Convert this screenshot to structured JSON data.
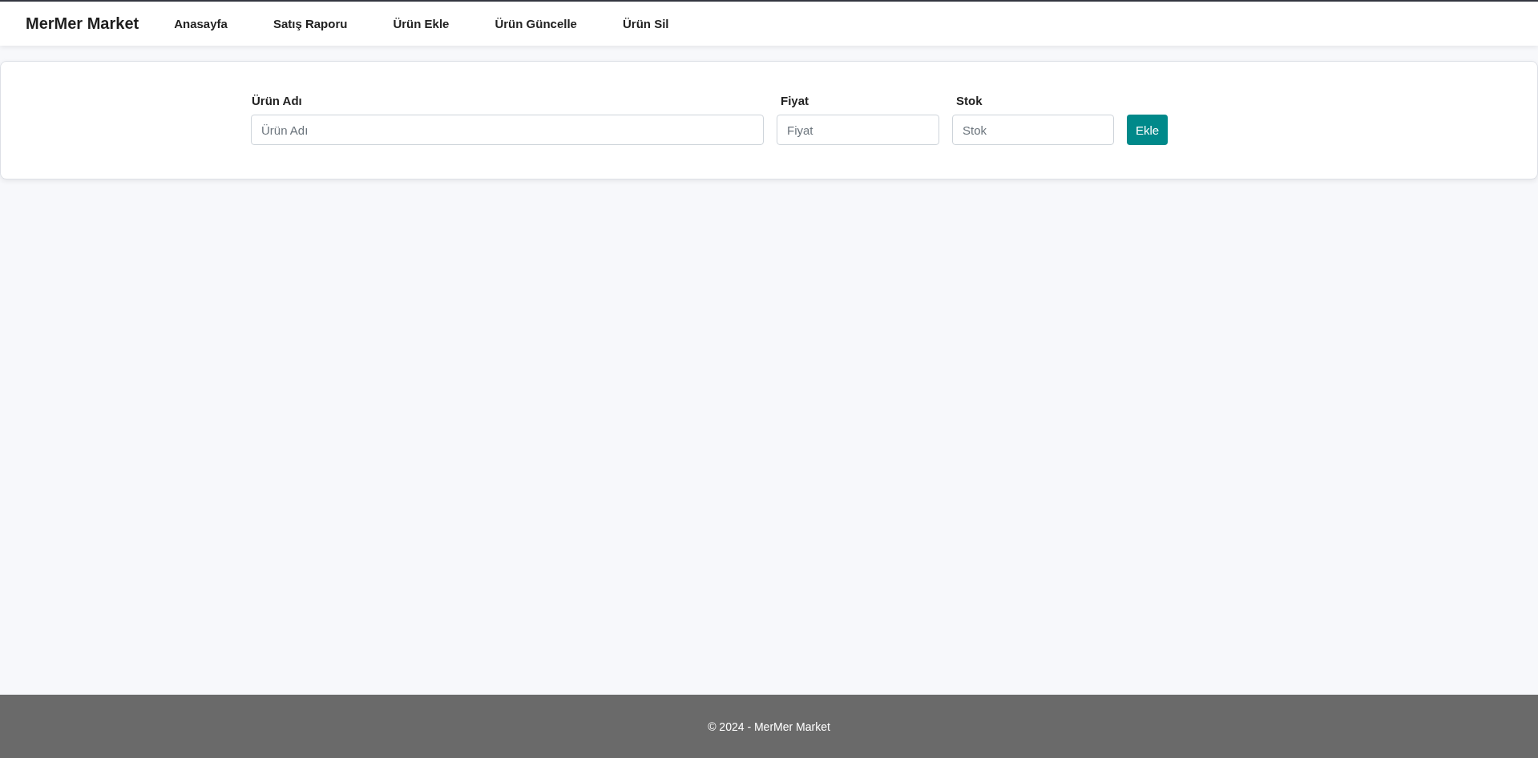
{
  "navbar": {
    "brand": "MerMer Market",
    "links": [
      "Anasayfa",
      "Satış Raporu",
      "Ürün Ekle",
      "Ürün Güncelle",
      "Ürün Sil"
    ]
  },
  "form": {
    "fields": [
      {
        "label": "Ürün Adı",
        "placeholder": "Ürün Adı"
      },
      {
        "label": "Fiyat",
        "placeholder": "Fiyat"
      },
      {
        "label": "Stok",
        "placeholder": "Stok"
      }
    ],
    "button": "Ekle"
  },
  "footer": {
    "text": "© 2024 - MerMer Market"
  }
}
